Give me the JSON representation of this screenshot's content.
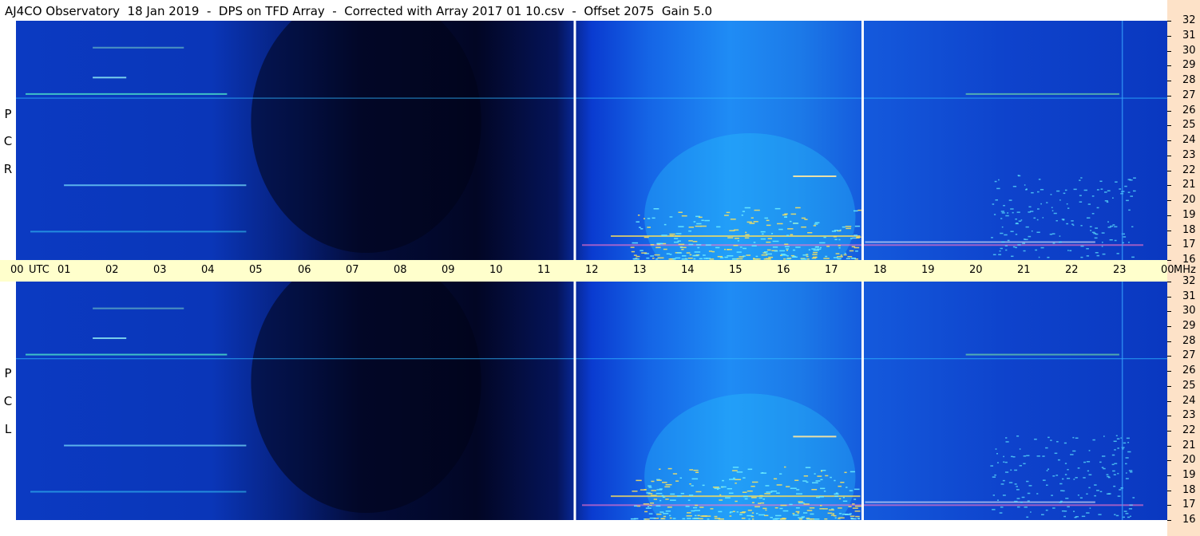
{
  "title": "AJ4CO Observatory  18 Jan 2019  -  DPS on TFD Array  -  Corrected with Array 2017 01 10.csv  -  Offset 2075  Gain 5.0",
  "chart_data": [
    {
      "type": "heatmap",
      "panel": "top",
      "polarization_label": [
        "R",
        "C",
        "P"
      ],
      "x": {
        "unit": "UTC hours",
        "range": [
          0,
          24
        ]
      },
      "y": {
        "unit": "MHz",
        "range": [
          16,
          32
        ],
        "ticks": [
          16,
          17,
          18,
          19,
          20,
          21,
          22,
          23,
          24,
          25,
          26,
          27,
          28,
          29,
          30,
          31,
          32
        ]
      },
      "markers_utc_hours": [
        11.65,
        17.65
      ]
    },
    {
      "type": "heatmap",
      "panel": "bottom",
      "polarization_label": [
        "L",
        "C",
        "P"
      ],
      "x": {
        "unit": "UTC hours",
        "range": [
          0,
          24
        ]
      },
      "y": {
        "unit": "MHz",
        "range": [
          16,
          32
        ],
        "ticks": [
          16,
          17,
          18,
          19,
          20,
          21,
          22,
          23,
          24,
          25,
          26,
          27,
          28,
          29,
          30,
          31,
          32
        ]
      },
      "markers_utc_hours": [
        11.65,
        17.65
      ]
    }
  ],
  "time_axis": {
    "labels": [
      "00",
      "01",
      "02",
      "03",
      "04",
      "05",
      "06",
      "07",
      "08",
      "09",
      "10",
      "11",
      "12",
      "13",
      "14",
      "15",
      "16",
      "17",
      "18",
      "19",
      "20",
      "21",
      "22",
      "23",
      "00"
    ],
    "utc_label": "UTC",
    "unit_label": "MHz"
  },
  "colors": {
    "background_dark": "#02082b",
    "mid_blue": "#0a3fd0",
    "day_cyan": "#1fa6ff",
    "hot": "#ffe05a",
    "timebar": "#ffffcc",
    "right_strip": "#fde2c8"
  }
}
